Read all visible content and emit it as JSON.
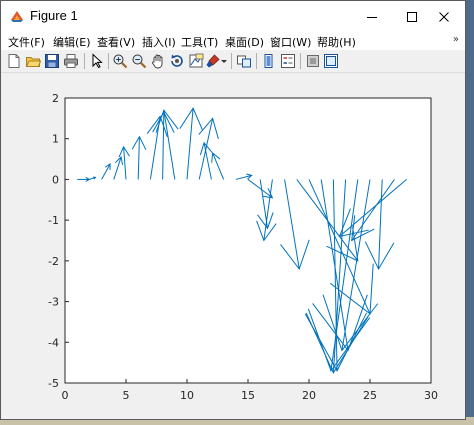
{
  "window": {
    "title": "Figure 1",
    "controls": {
      "minimize": "minimize",
      "maximize": "maximize",
      "close": "close"
    }
  },
  "menu": {
    "items": [
      {
        "label": "文件(F)"
      },
      {
        "label": "编辑(E)"
      },
      {
        "label": "查看(V)"
      },
      {
        "label": "插入(I)"
      },
      {
        "label": "工具(T)"
      },
      {
        "label": "桌面(D)"
      },
      {
        "label": "窗口(W)"
      },
      {
        "label": "帮助(H)"
      }
    ],
    "overflow_glyph": "»"
  },
  "toolbar": {
    "icons": [
      "new-figure-icon",
      "open-file-icon",
      "save-icon",
      "print-icon",
      "pointer-icon",
      "zoom-in-icon",
      "zoom-out-icon",
      "pan-icon",
      "rotate-3d-icon",
      "data-cursor-icon",
      "brush-icon",
      "brush-dropdown-icon",
      "link-plot-icon",
      "colorbar-icon",
      "legend-icon",
      "hide-plot-tools-icon",
      "show-plot-tools-icon"
    ]
  },
  "chart_data": {
    "type": "quiver",
    "title": "",
    "xlabel": "",
    "ylabel": "",
    "xlim": [
      0,
      30
    ],
    "ylim": [
      -5,
      2
    ],
    "xticks": [
      "0",
      "5",
      "10",
      "15",
      "20",
      "25",
      "30"
    ],
    "yticks": [
      "2",
      "1",
      "0",
      "-1",
      "-2",
      "-3",
      "-4",
      "-5"
    ],
    "grid": false,
    "color": "#0072bd",
    "arrows": [
      {
        "x": 1,
        "y": 0,
        "u": 1.0,
        "v": 0.0
      },
      {
        "x": 2,
        "y": 0,
        "u": 0.5,
        "v": 0.05
      },
      {
        "x": 3,
        "y": 0,
        "u": 0.7,
        "v": 0.38
      },
      {
        "x": 4,
        "y": 0,
        "u": 0.6,
        "v": 0.55
      },
      {
        "x": 5,
        "y": 0,
        "u": -0.2,
        "v": 0.8
      },
      {
        "x": 6,
        "y": 0,
        "u": 0.1,
        "v": 1.05
      },
      {
        "x": 7,
        "y": 0,
        "u": 0.8,
        "v": 1.55
      },
      {
        "x": 8,
        "y": 0,
        "u": 0.1,
        "v": 1.65
      },
      {
        "x": 9,
        "y": 0,
        "u": -0.9,
        "v": 1.7
      },
      {
        "x": 10,
        "y": 0,
        "u": 0.5,
        "v": 1.75
      },
      {
        "x": 11,
        "y": 0,
        "u": 1.1,
        "v": 1.5
      },
      {
        "x": 12,
        "y": 0,
        "u": -0.6,
        "v": 0.9
      },
      {
        "x": 13,
        "y": 0,
        "u": -0.9,
        "v": 0.65
      },
      {
        "x": 14,
        "y": 0,
        "u": 1.3,
        "v": 0.1
      },
      {
        "x": 15,
        "y": 0,
        "u": 2.0,
        "v": -0.45
      },
      {
        "x": 16,
        "y": 0,
        "u": 0.6,
        "v": -1.2
      },
      {
        "x": 17,
        "y": 0,
        "u": -0.7,
        "v": -1.5
      },
      {
        "x": 18,
        "y": 0,
        "u": 1.2,
        "v": -2.2
      },
      {
        "x": 19,
        "y": 0,
        "u": 5.0,
        "v": -2.0
      },
      {
        "x": 20,
        "y": 0,
        "u": 5.0,
        "v": -3.3
      },
      {
        "x": 21,
        "y": 0,
        "u": 2.2,
        "v": -4.2
      },
      {
        "x": 22,
        "y": 0,
        "u": 0.3,
        "v": -4.7
      },
      {
        "x": 23,
        "y": 0,
        "u": -1.0,
        "v": -4.75
      },
      {
        "x": 24,
        "y": 0,
        "u": -2.2,
        "v": -4.7
      },
      {
        "x": 25,
        "y": 0,
        "u": -2.3,
        "v": -4.2
      },
      {
        "x": 26,
        "y": 0,
        "u": -0.3,
        "v": -2.2
      },
      {
        "x": 27,
        "y": 0,
        "u": -3.5,
        "v": -1.5
      },
      {
        "x": 28,
        "y": 0,
        "u": -5.5,
        "v": -1.4
      }
    ]
  }
}
